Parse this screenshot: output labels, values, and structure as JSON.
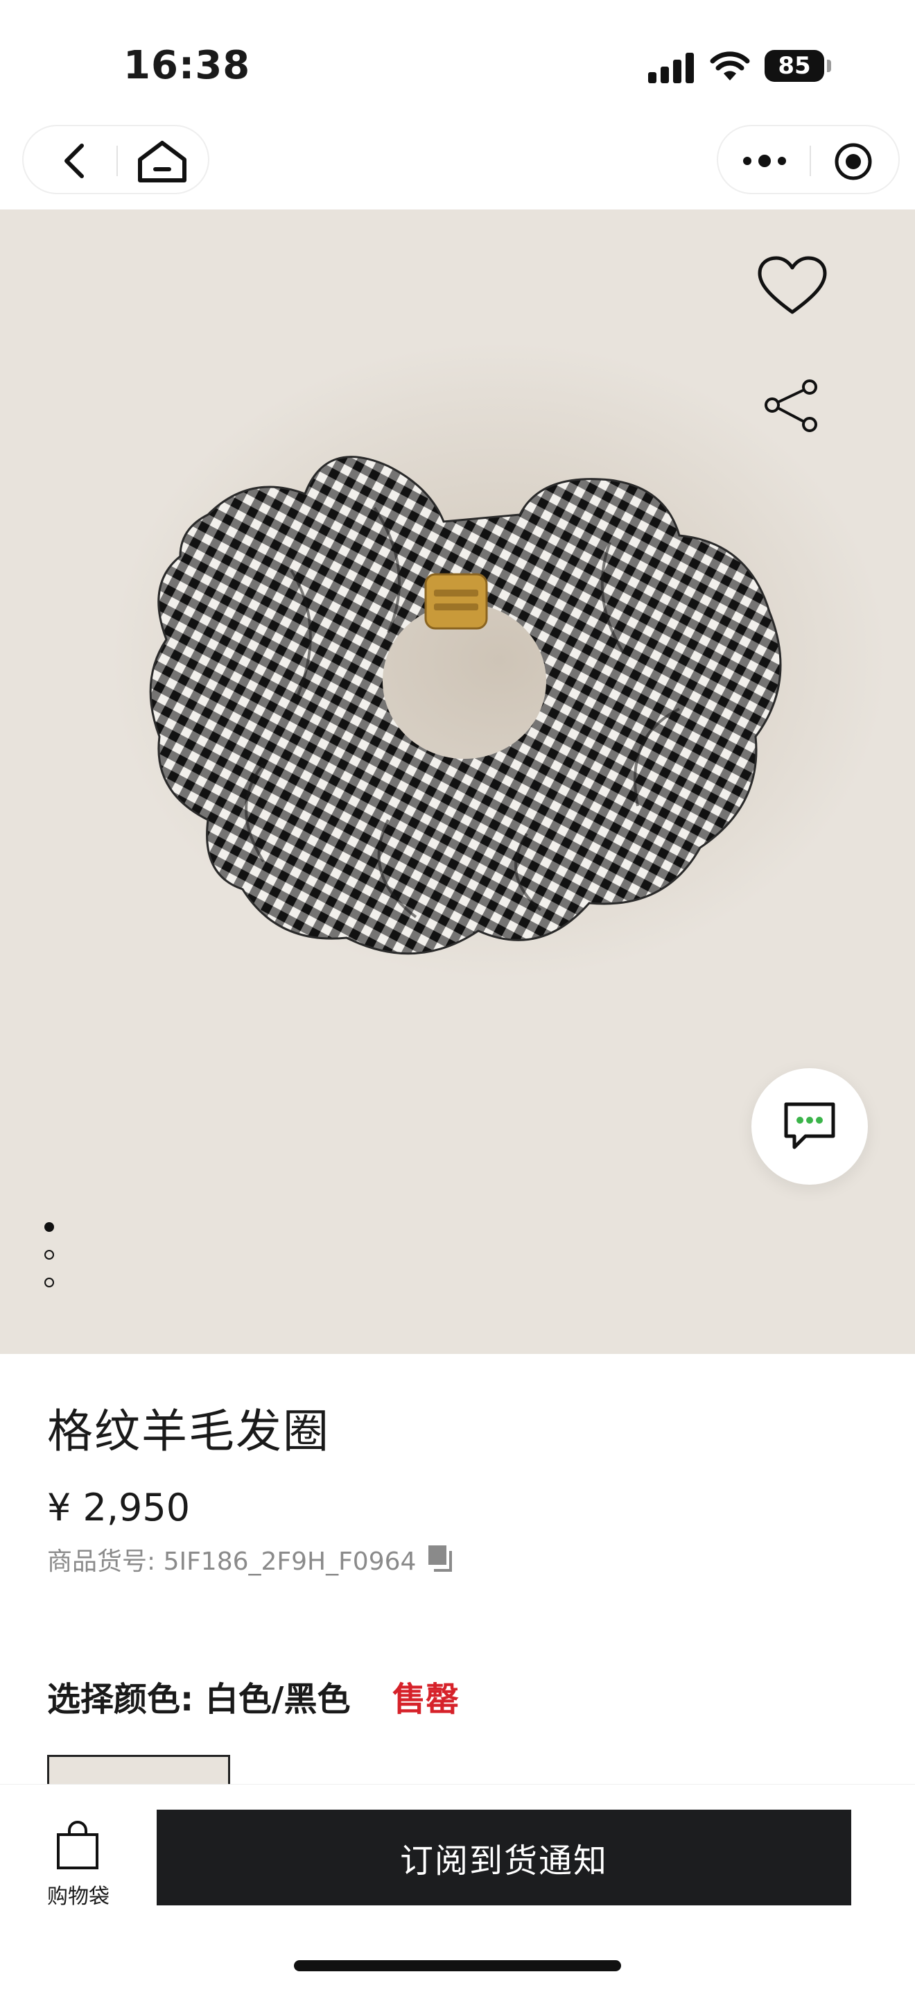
{
  "status_bar": {
    "time": "16:38",
    "battery": "85"
  },
  "product": {
    "title": "格纹羊毛发圈",
    "price": "¥ 2,950",
    "sku_label": "商品货号: 5IF186_2F9H_F0964",
    "color_label": "选择颜色: 白色/黑色",
    "stock_status": "售罄"
  },
  "gallery": {
    "image_count": 3,
    "current_index": 1
  },
  "bottom_bar": {
    "bag_label": "购物袋",
    "notify_button": "订阅到货通知"
  },
  "colors": {
    "hero_bg": "#e8e3dc",
    "soldout": "#d6222a",
    "button_bg": "#1c1d1f",
    "chat_dots": "#3bb44a"
  }
}
